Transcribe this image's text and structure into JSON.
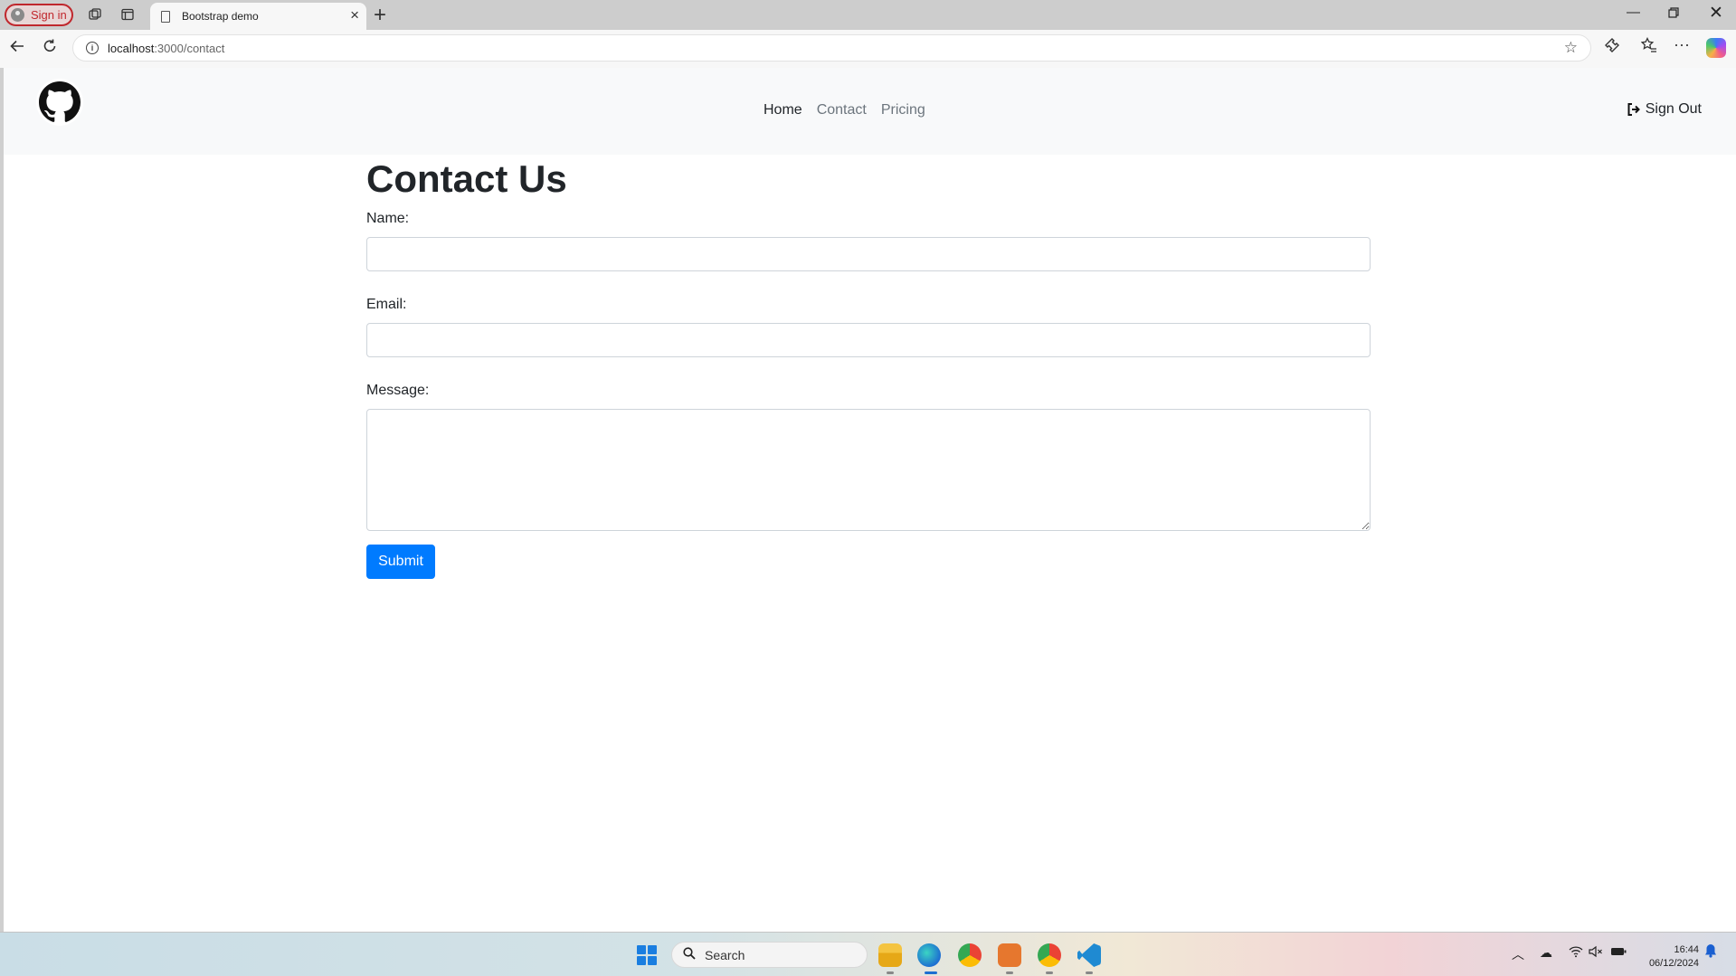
{
  "browser": {
    "profile_label": "Sign in",
    "tab_title": "Bootstrap demo",
    "url_host": "localhost",
    "url_path": ":3000/contact"
  },
  "navbar": {
    "links": [
      {
        "label": "Home"
      },
      {
        "label": "Contact"
      },
      {
        "label": "Pricing"
      }
    ],
    "signout_label": "Sign Out"
  },
  "page": {
    "title": "Contact Us",
    "name_label": "Name:",
    "email_label": "Email:",
    "message_label": "Message:",
    "submit_label": "Submit"
  },
  "taskbar": {
    "search_placeholder": "Search",
    "time": "16:44",
    "date": "06/12/2024"
  },
  "colors": {
    "primary": "#007bff",
    "navbar_bg": "#f8f9fa"
  }
}
